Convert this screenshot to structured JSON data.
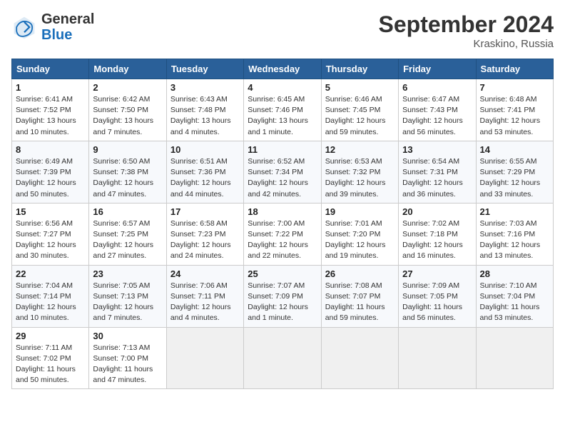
{
  "header": {
    "logo_general": "General",
    "logo_blue": "Blue",
    "month": "September 2024",
    "location": "Kraskino, Russia"
  },
  "days_of_week": [
    "Sunday",
    "Monday",
    "Tuesday",
    "Wednesday",
    "Thursday",
    "Friday",
    "Saturday"
  ],
  "weeks": [
    [
      {
        "day": "1",
        "detail": "Sunrise: 6:41 AM\nSunset: 7:52 PM\nDaylight: 13 hours\nand 10 minutes."
      },
      {
        "day": "2",
        "detail": "Sunrise: 6:42 AM\nSunset: 7:50 PM\nDaylight: 13 hours\nand 7 minutes."
      },
      {
        "day": "3",
        "detail": "Sunrise: 6:43 AM\nSunset: 7:48 PM\nDaylight: 13 hours\nand 4 minutes."
      },
      {
        "day": "4",
        "detail": "Sunrise: 6:45 AM\nSunset: 7:46 PM\nDaylight: 13 hours\nand 1 minute."
      },
      {
        "day": "5",
        "detail": "Sunrise: 6:46 AM\nSunset: 7:45 PM\nDaylight: 12 hours\nand 59 minutes."
      },
      {
        "day": "6",
        "detail": "Sunrise: 6:47 AM\nSunset: 7:43 PM\nDaylight: 12 hours\nand 56 minutes."
      },
      {
        "day": "7",
        "detail": "Sunrise: 6:48 AM\nSunset: 7:41 PM\nDaylight: 12 hours\nand 53 minutes."
      }
    ],
    [
      {
        "day": "8",
        "detail": "Sunrise: 6:49 AM\nSunset: 7:39 PM\nDaylight: 12 hours\nand 50 minutes."
      },
      {
        "day": "9",
        "detail": "Sunrise: 6:50 AM\nSunset: 7:38 PM\nDaylight: 12 hours\nand 47 minutes."
      },
      {
        "day": "10",
        "detail": "Sunrise: 6:51 AM\nSunset: 7:36 PM\nDaylight: 12 hours\nand 44 minutes."
      },
      {
        "day": "11",
        "detail": "Sunrise: 6:52 AM\nSunset: 7:34 PM\nDaylight: 12 hours\nand 42 minutes."
      },
      {
        "day": "12",
        "detail": "Sunrise: 6:53 AM\nSunset: 7:32 PM\nDaylight: 12 hours\nand 39 minutes."
      },
      {
        "day": "13",
        "detail": "Sunrise: 6:54 AM\nSunset: 7:31 PM\nDaylight: 12 hours\nand 36 minutes."
      },
      {
        "day": "14",
        "detail": "Sunrise: 6:55 AM\nSunset: 7:29 PM\nDaylight: 12 hours\nand 33 minutes."
      }
    ],
    [
      {
        "day": "15",
        "detail": "Sunrise: 6:56 AM\nSunset: 7:27 PM\nDaylight: 12 hours\nand 30 minutes."
      },
      {
        "day": "16",
        "detail": "Sunrise: 6:57 AM\nSunset: 7:25 PM\nDaylight: 12 hours\nand 27 minutes."
      },
      {
        "day": "17",
        "detail": "Sunrise: 6:58 AM\nSunset: 7:23 PM\nDaylight: 12 hours\nand 24 minutes."
      },
      {
        "day": "18",
        "detail": "Sunrise: 7:00 AM\nSunset: 7:22 PM\nDaylight: 12 hours\nand 22 minutes."
      },
      {
        "day": "19",
        "detail": "Sunrise: 7:01 AM\nSunset: 7:20 PM\nDaylight: 12 hours\nand 19 minutes."
      },
      {
        "day": "20",
        "detail": "Sunrise: 7:02 AM\nSunset: 7:18 PM\nDaylight: 12 hours\nand 16 minutes."
      },
      {
        "day": "21",
        "detail": "Sunrise: 7:03 AM\nSunset: 7:16 PM\nDaylight: 12 hours\nand 13 minutes."
      }
    ],
    [
      {
        "day": "22",
        "detail": "Sunrise: 7:04 AM\nSunset: 7:14 PM\nDaylight: 12 hours\nand 10 minutes."
      },
      {
        "day": "23",
        "detail": "Sunrise: 7:05 AM\nSunset: 7:13 PM\nDaylight: 12 hours\nand 7 minutes."
      },
      {
        "day": "24",
        "detail": "Sunrise: 7:06 AM\nSunset: 7:11 PM\nDaylight: 12 hours\nand 4 minutes."
      },
      {
        "day": "25",
        "detail": "Sunrise: 7:07 AM\nSunset: 7:09 PM\nDaylight: 12 hours\nand 1 minute."
      },
      {
        "day": "26",
        "detail": "Sunrise: 7:08 AM\nSunset: 7:07 PM\nDaylight: 11 hours\nand 59 minutes."
      },
      {
        "day": "27",
        "detail": "Sunrise: 7:09 AM\nSunset: 7:05 PM\nDaylight: 11 hours\nand 56 minutes."
      },
      {
        "day": "28",
        "detail": "Sunrise: 7:10 AM\nSunset: 7:04 PM\nDaylight: 11 hours\nand 53 minutes."
      }
    ],
    [
      {
        "day": "29",
        "detail": "Sunrise: 7:11 AM\nSunset: 7:02 PM\nDaylight: 11 hours\nand 50 minutes."
      },
      {
        "day": "30",
        "detail": "Sunrise: 7:13 AM\nSunset: 7:00 PM\nDaylight: 11 hours\nand 47 minutes."
      },
      {
        "day": "",
        "detail": ""
      },
      {
        "day": "",
        "detail": ""
      },
      {
        "day": "",
        "detail": ""
      },
      {
        "day": "",
        "detail": ""
      },
      {
        "day": "",
        "detail": ""
      }
    ]
  ]
}
